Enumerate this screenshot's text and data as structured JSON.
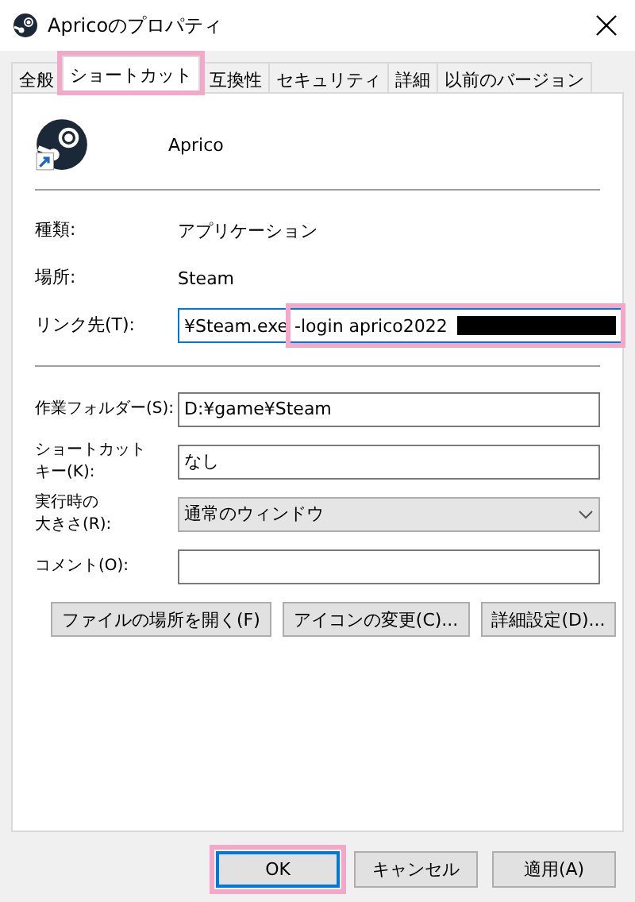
{
  "window": {
    "title": "Apricoのプロパティ"
  },
  "tabs": [
    {
      "label": "全般",
      "selected": false,
      "highlighted": false
    },
    {
      "label": "ショートカット",
      "selected": true,
      "highlighted": true
    },
    {
      "label": "互換性",
      "selected": false,
      "highlighted": false
    },
    {
      "label": "セキュリティ",
      "selected": false,
      "highlighted": false
    },
    {
      "label": "詳細",
      "selected": false,
      "highlighted": false
    },
    {
      "label": "以前のバージョン",
      "selected": false,
      "highlighted": false
    }
  ],
  "shortcut_name": "Aprico",
  "info": [
    {
      "label": "種類:",
      "value": "アプリケーション"
    },
    {
      "label": "場所:",
      "value": "Steam"
    }
  ],
  "target": {
    "label": "リンク先(T):",
    "value_start": "¥Steam.exe",
    "value_end": "-login aprico2022",
    "highlighted": true,
    "redacted": true
  },
  "fields": [
    {
      "kind": "text",
      "label_lines": [
        "作業フォルダー(S):"
      ],
      "value": "D:¥game¥Steam"
    },
    {
      "kind": "text",
      "label_lines": [
        "ショートカット",
        "キー(K):"
      ],
      "value": "なし"
    },
    {
      "kind": "select",
      "label_lines": [
        "実行時の",
        "大きさ(R):"
      ],
      "value": "通常のウィンドウ"
    },
    {
      "kind": "text",
      "label_lines": [
        "コメント(O):"
      ]
    }
  ],
  "actions": [
    "ファイルの場所を開く(F)",
    "アイコンの変更(C)...",
    "詳細設定(D)..."
  ],
  "buttons": [
    {
      "label": "OK",
      "default": true,
      "highlighted": true
    },
    {
      "label": "キャンセル",
      "default": false,
      "highlighted": false
    },
    {
      "label": "適用(A)",
      "default": false,
      "highlighted": false
    }
  ]
}
